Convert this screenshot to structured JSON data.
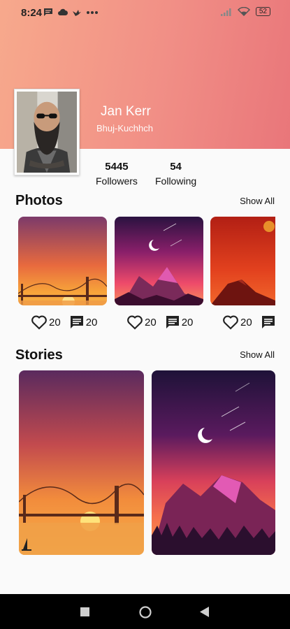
{
  "status_bar": {
    "time": "8:24",
    "battery": "52",
    "left_icons": [
      "message-icon",
      "cloud-icon",
      "bird-icon",
      "more-dots-icon"
    ],
    "right_icons": [
      "signal-icon",
      "wifi-icon",
      "battery-icon"
    ]
  },
  "profile": {
    "name": "Jan Kerr",
    "location": "Bhuj-Kuchhch",
    "header_gradient": [
      "#f7a98c",
      "#e9767a"
    ]
  },
  "stats": {
    "followers": {
      "value": "5445",
      "label": "Followers"
    },
    "following": {
      "value": "54",
      "label": "Following"
    }
  },
  "photos": {
    "title": "Photos",
    "show_all": "Show All",
    "items": [
      {
        "likes": "20",
        "comments": "20"
      },
      {
        "likes": "20",
        "comments": "20"
      },
      {
        "likes": "20",
        "comments": ""
      }
    ]
  },
  "stories": {
    "title": "Stories",
    "show_all": "Show All"
  },
  "nav_bar": {
    "buttons": [
      "recents-square-icon",
      "home-circle-icon",
      "back-triangle-icon"
    ]
  }
}
